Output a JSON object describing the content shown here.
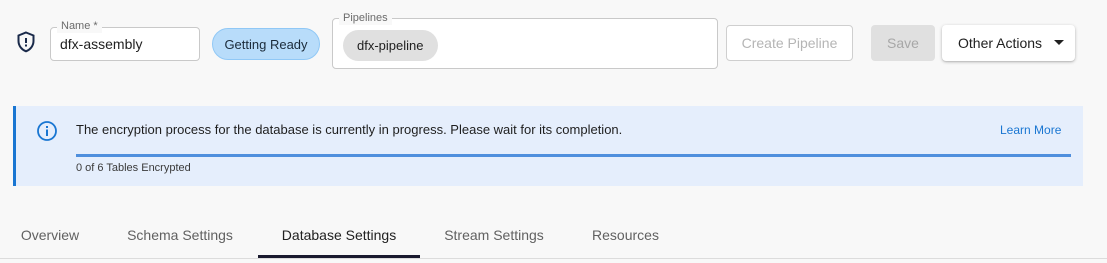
{
  "header": {
    "name_label": "Name *",
    "name_value": "dfx-assembly",
    "status": "Getting Ready",
    "pipelines_label": "Pipelines",
    "pipelines": [
      "dfx-pipeline"
    ],
    "create_pipeline_label": "Create Pipeline",
    "save_label": "Save",
    "other_actions_label": "Other Actions"
  },
  "alert": {
    "message": "The encryption process for the database is currently in progress. Please wait for its completion.",
    "learn_more": "Learn More",
    "progress_text": "0 of 6 Tables Encrypted",
    "progress_fraction": 1.0
  },
  "tabs": [
    {
      "label": "Overview"
    },
    {
      "label": "Schema Settings"
    },
    {
      "label": "Database Settings",
      "active": true
    },
    {
      "label": "Stream Settings"
    },
    {
      "label": "Resources"
    }
  ],
  "colors": {
    "accent": "#1976d2",
    "status_chip": "#b8dcfa",
    "alert_bg": "#e5eefc"
  },
  "icons": {
    "shield": "shield-icon",
    "info": "info-icon",
    "caret": "caret-down-icon"
  }
}
